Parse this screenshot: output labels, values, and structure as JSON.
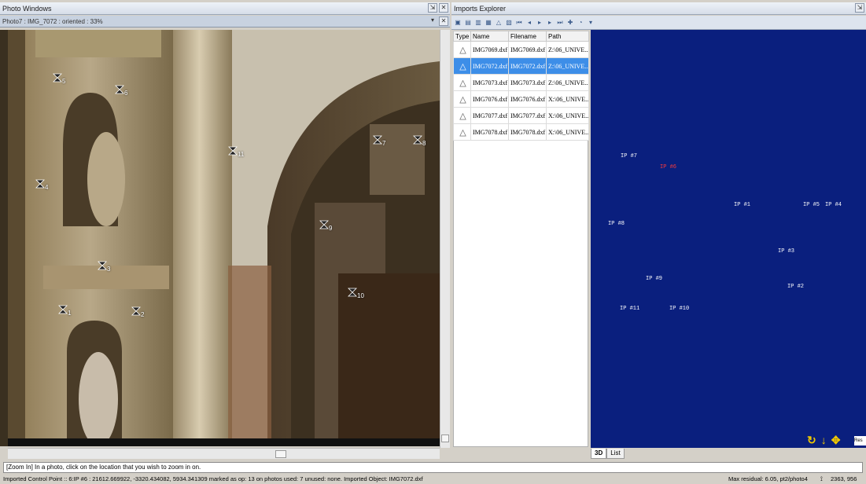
{
  "left_panel": {
    "title": "Photo Windows",
    "photo_caption": "Photo7 : IMG_7072 : oriented : 33%",
    "markers": [
      {
        "label": "5"
      },
      {
        "label": "6"
      },
      {
        "label": "4"
      },
      {
        "label": "11"
      },
      {
        "label": "7"
      },
      {
        "label": "8"
      },
      {
        "label": "9"
      },
      {
        "label": "3"
      },
      {
        "label": "1"
      },
      {
        "label": "2"
      },
      {
        "label": "10"
      }
    ]
  },
  "right_panel": {
    "title": "Imports Explorer",
    "table": {
      "columns": [
        "Type",
        "Name",
        "Filename",
        "Path"
      ],
      "rows": [
        {
          "name": "IMG7069.dxf",
          "filename": "IMG7069.dxf",
          "path": "Z:\\06_UNIVE...",
          "selected": false
        },
        {
          "name": "IMG7072.dxf",
          "filename": "IMG7072.dxf",
          "path": "Z:\\06_UNIVE...",
          "selected": true
        },
        {
          "name": "IMG7073.dxf",
          "filename": "IMG7073.dxf",
          "path": "Z:\\06_UNIVE...",
          "selected": false
        },
        {
          "name": "IMG7076.dxf",
          "filename": "IMG7076.dxf",
          "path": "X:\\06_UNIVE...",
          "selected": false
        },
        {
          "name": "IMG7077.dxf",
          "filename": "IMG7077.dxf",
          "path": "X:\\06_UNIVE...",
          "selected": false
        },
        {
          "name": "IMG7078.dxf",
          "filename": "IMG7078.dxf",
          "path": "X:\\06_UNIVE...",
          "selected": false
        }
      ]
    },
    "control_points": [
      {
        "label": "IP #7",
        "red": false
      },
      {
        "label": "IP #6",
        "red": true
      },
      {
        "label": "IP #1",
        "red": false
      },
      {
        "label": "IP #5",
        "red": false
      },
      {
        "label": "IP #4",
        "red": false
      },
      {
        "label": "IP #8",
        "red": false
      },
      {
        "label": "IP #3",
        "red": false
      },
      {
        "label": "IP #9",
        "red": false
      },
      {
        "label": "IP #2",
        "red": false
      },
      {
        "label": "IP #11",
        "red": false
      },
      {
        "label": "IP #10",
        "red": false
      }
    ],
    "tabs": [
      "3D",
      "List"
    ],
    "res_label": "Res"
  },
  "command_line": "[Zoom In] In a photo, click on the location that you wish to zoom in on.",
  "status": {
    "left": "Imported Control Point :: 6:IP #6 : 21612.669922, -3320.434082, 5934.341309  marked as op: 13 on photos used: 7   unused: none. Imported Object: IMG7072.dxf",
    "residual": "Max residual: 6.05, pt2/photo4",
    "coords": "2363, 956"
  }
}
